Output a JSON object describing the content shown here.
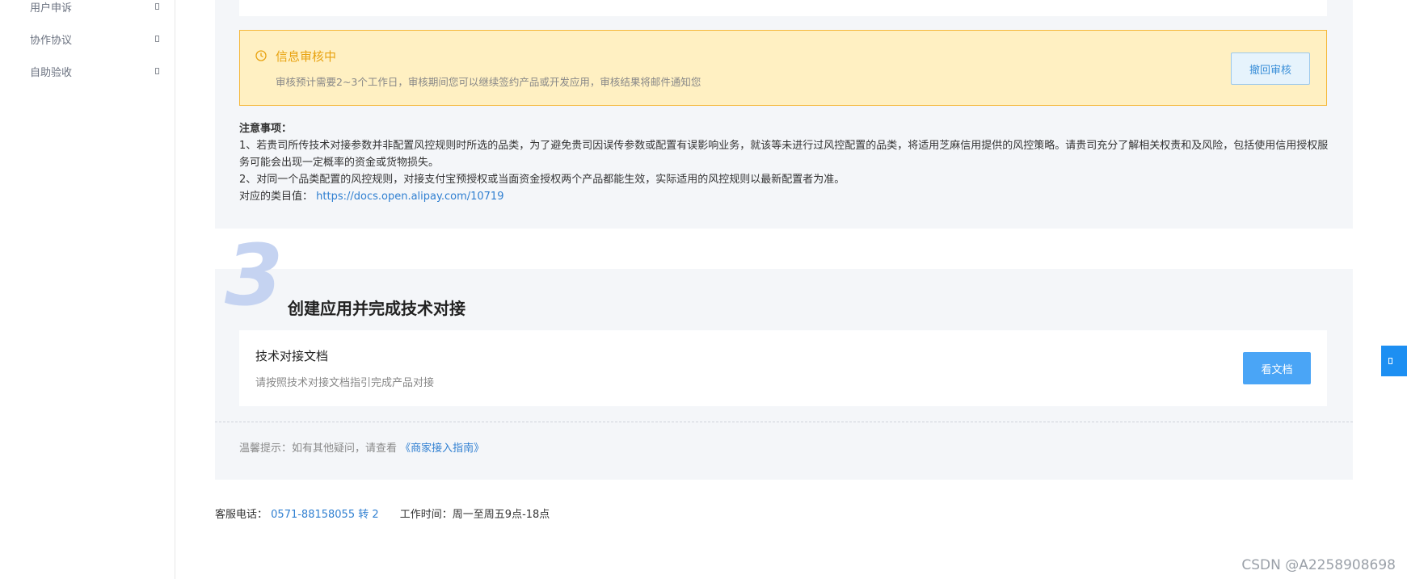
{
  "sidebar": {
    "items": [
      {
        "label": "用户申诉"
      },
      {
        "label": "协作协议"
      },
      {
        "label": "自助验收"
      }
    ]
  },
  "review_alert": {
    "title": "信息审核中",
    "description": "审核预计需要2~3个工作日，审核期间您可以继续签约产品或开发应用，审核结果将邮件通知您",
    "button_label": "撤回审核",
    "icon": "clock-icon"
  },
  "notes": {
    "heading": "注意事项：",
    "line1": "1、若贵司所传技术对接参数并非配置风控规则时所选的品类，为了避免贵司因误传参数或配置有误影响业务，就该等未进行过风控配置的品类，将适用芝麻信用提供的风控策略。请贵司充分了解相关权责和及风险，包括使用信用授权服务可能会出现一定概率的资金或货物损失。",
    "line2": "2、对同一个品类配置的风控规则，对接支付宝预授权或当面资金授权两个产品都能生效，实际适用的风控规则以最新配置者为准。",
    "category_label": "对应的类目值：",
    "category_link": "https://docs.open.alipay.com/10719"
  },
  "step3": {
    "number": "3",
    "title": "创建应用并完成技术对接",
    "doc_card": {
      "title": "技术对接文档",
      "description": "请按照技术对接文档指引完成产品对接",
      "button_label": "看文档"
    },
    "tip_prefix": "温馨提示：如有其他疑问，请查看",
    "tip_link": "《商家接入指南》"
  },
  "footer": {
    "phone_label": "客服电话：",
    "phone": "0571-88158055 转 2",
    "hours_label": "工作时间：",
    "hours": "周一至周五9点-18点"
  },
  "watermark": "CSDN @A2258908698",
  "colors": {
    "accent": "#1d8ff2",
    "warning_bg": "#fff0c2",
    "warning_border": "#f5b83a",
    "link": "#2f7fd1"
  }
}
